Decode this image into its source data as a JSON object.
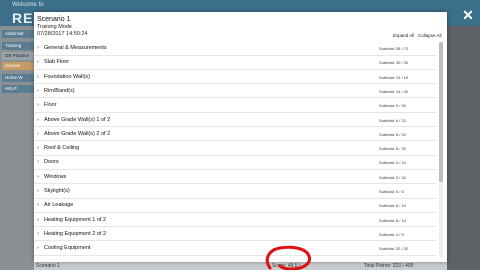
{
  "background": {
    "welcome": "Welcome to",
    "brand": "RESI",
    "sidebar": [
      "Administr",
      "Training",
      "OS Practice",
      "Scenari",
      "Home W",
      "HELP"
    ],
    "footer_left": "Scenario 1",
    "footer_mid": "Score: 49.5 / ...",
    "footer_right": "Total Points: 323 / 400"
  },
  "close_glyph": "✕",
  "modal": {
    "title": "Scenario 1",
    "subtitle": "Training Mode",
    "datetime": "07/28/2017 14:50:24",
    "expand_all": "Expand All",
    "collapse_all": "Collapse All",
    "rows": [
      {
        "label": "General & Measurements",
        "subtotal": "Subtotal: 35 / 72"
      },
      {
        "label": "Slab Floor",
        "subtotal": "Subtotal: 30 / 30"
      },
      {
        "label": "Foundation Wall(s)",
        "subtotal": "Subtotal: 13 / 19"
      },
      {
        "label": "Rim/Band(s)",
        "subtotal": "Subtotal: 14 / 42"
      },
      {
        "label": "Floor",
        "subtotal": "Subtotal: 9 / 45"
      },
      {
        "label": "Above Grade Wall(s) 1 of 2",
        "subtotal": "Subtotal: 6 / 22"
      },
      {
        "label": "Above Grade Wall(s) 2 of 2",
        "subtotal": "Subtotal: 6 / 22"
      },
      {
        "label": "Roof & Ceiling",
        "subtotal": "Subtotal: 6 / 20"
      },
      {
        "label": "Doors",
        "subtotal": "Subtotal: 0 / 12"
      },
      {
        "label": "Windows",
        "subtotal": "Subtotal: 3 / 42"
      },
      {
        "label": "Skylight(s)",
        "subtotal": "Subtotal: 0 / 6"
      },
      {
        "label": "Air Leakage",
        "subtotal": "Subtotal: 6 / 10"
      },
      {
        "label": "Heating Equipment 1 of 2",
        "subtotal": "Subtotal: 8 / 14"
      },
      {
        "label": "Heating Equipment 2 of 2",
        "subtotal": "Subtotal: 3 / 5"
      },
      {
        "label": "Cooling Equipment",
        "subtotal": "Subtotal: 32 / 32"
      }
    ]
  },
  "colors": {
    "annotation": "#e01010",
    "header_bg": "#3c6f8a"
  }
}
